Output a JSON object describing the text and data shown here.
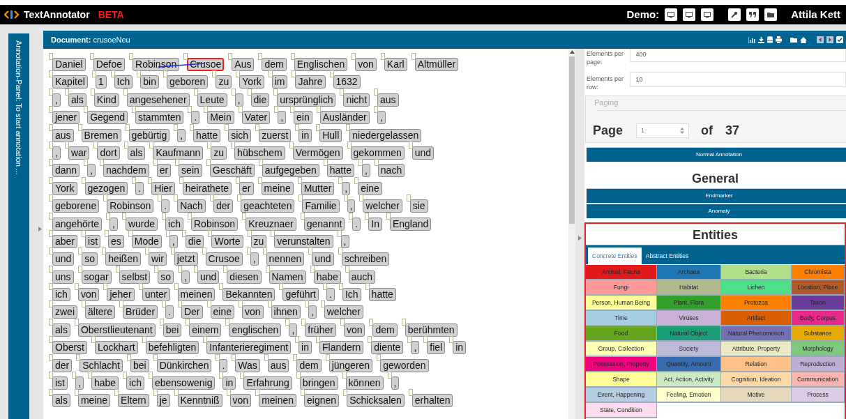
{
  "app": {
    "title": "TextAnnotator",
    "badge": "BETA",
    "demo_label": "Demo:",
    "user": "Attila Kett"
  },
  "sidebar": {
    "label": "Annotation-Panel: To start annotation ..."
  },
  "document": {
    "label": "Document:",
    "name": "crusoeNeu"
  },
  "rows": [
    [
      {
        "text": "Daniel",
        "selected": false
      },
      {
        "text": "Defoe",
        "selected": false
      },
      {
        "text": "Robinson",
        "selected": false,
        "linked_to_next": true
      },
      {
        "text": "Crusoe",
        "selected": true
      },
      {
        "text": "Aus",
        "selected": false
      },
      {
        "text": "dem",
        "selected": false
      },
      {
        "text": "Englischen",
        "selected": false
      },
      {
        "text": "von",
        "selected": false
      },
      {
        "text": "Karl",
        "selected": false
      },
      {
        "text": "Altmüller",
        "selected": false
      }
    ],
    [
      {
        "text": "Kapitel",
        "selected": false
      },
      {
        "text": "1",
        "selected": false
      },
      {
        "text": "Ich",
        "selected": false
      },
      {
        "text": "bin",
        "selected": false
      },
      {
        "text": "geboren",
        "selected": false
      },
      {
        "text": "zu",
        "selected": false
      },
      {
        "text": "York",
        "selected": false
      },
      {
        "text": "im",
        "selected": false
      },
      {
        "text": "Jahre",
        "selected": false
      },
      {
        "text": "1632",
        "selected": false
      }
    ],
    [
      {
        "text": ",",
        "selected": false
      },
      {
        "text": "als",
        "selected": false
      },
      {
        "text": "Kind",
        "selected": false
      },
      {
        "text": "angesehener",
        "selected": false
      },
      {
        "text": "Leute",
        "selected": false
      },
      {
        "text": ",",
        "selected": false
      },
      {
        "text": "die",
        "selected": false
      },
      {
        "text": "ursprünglich",
        "selected": false
      },
      {
        "text": "nicht",
        "selected": false
      },
      {
        "text": "aus",
        "selected": false
      }
    ],
    [
      {
        "text": "jener",
        "selected": false
      },
      {
        "text": "Gegend",
        "selected": false
      },
      {
        "text": "stammten",
        "selected": false
      },
      {
        "text": ".",
        "selected": false
      },
      {
        "text": "Mein",
        "selected": false
      },
      {
        "text": "Vater",
        "selected": false
      },
      {
        "text": ",",
        "selected": false
      },
      {
        "text": "ein",
        "selected": false
      },
      {
        "text": "Ausländer",
        "selected": false
      },
      {
        "text": ",",
        "selected": false
      }
    ],
    [
      {
        "text": "aus",
        "selected": false
      },
      {
        "text": "Bremen",
        "selected": false
      },
      {
        "text": "gebürtig",
        "selected": false
      },
      {
        "text": ",",
        "selected": false
      },
      {
        "text": "hatte",
        "selected": false
      },
      {
        "text": "sich",
        "selected": false
      },
      {
        "text": "zuerst",
        "selected": false
      },
      {
        "text": "in",
        "selected": false
      },
      {
        "text": "Hull",
        "selected": false
      },
      {
        "text": "niedergelassen",
        "selected": false
      }
    ],
    [
      {
        "text": ",",
        "selected": false
      },
      {
        "text": "war",
        "selected": false
      },
      {
        "text": "dort",
        "selected": false
      },
      {
        "text": "als",
        "selected": false
      },
      {
        "text": "Kaufmann",
        "selected": false
      },
      {
        "text": "zu",
        "selected": false
      },
      {
        "text": "hübschem",
        "selected": false
      },
      {
        "text": "Vermögen",
        "selected": false
      },
      {
        "text": "gekommen",
        "selected": false
      },
      {
        "text": "und",
        "selected": false
      }
    ],
    [
      {
        "text": "dann",
        "selected": false
      },
      {
        "text": ",",
        "selected": false
      },
      {
        "text": "nachdem",
        "selected": false
      },
      {
        "text": "er",
        "selected": false
      },
      {
        "text": "sein",
        "selected": false
      },
      {
        "text": "Geschäft",
        "selected": false
      },
      {
        "text": "aufgegeben",
        "selected": false
      },
      {
        "text": "hatte",
        "selected": false
      },
      {
        "text": ",",
        "selected": false
      },
      {
        "text": "nach",
        "selected": false
      }
    ],
    [
      {
        "text": "York",
        "selected": false
      },
      {
        "text": "gezogen",
        "selected": false
      },
      {
        "text": ".",
        "selected": false
      },
      {
        "text": "Hier",
        "selected": false
      },
      {
        "text": "heirathete",
        "selected": false
      },
      {
        "text": "er",
        "selected": false
      },
      {
        "text": "meine",
        "selected": false
      },
      {
        "text": "Mutter",
        "selected": false
      },
      {
        "text": ",",
        "selected": false
      },
      {
        "text": "eine",
        "selected": false
      }
    ],
    [
      {
        "text": "geborene",
        "selected": false
      },
      {
        "text": "Robinson",
        "selected": false
      },
      {
        "text": ".",
        "selected": false
      },
      {
        "text": "Nach",
        "selected": false
      },
      {
        "text": "der",
        "selected": false
      },
      {
        "text": "geachteten",
        "selected": false
      },
      {
        "text": "Familie",
        "selected": false
      },
      {
        "text": ",",
        "selected": false
      },
      {
        "text": "welcher",
        "selected": false
      },
      {
        "text": "sie",
        "selected": false
      }
    ],
    [
      {
        "text": "angehörte",
        "selected": false
      },
      {
        "text": ",",
        "selected": false
      },
      {
        "text": "wurde",
        "selected": false
      },
      {
        "text": "ich",
        "selected": false
      },
      {
        "text": "Robinson",
        "selected": false
      },
      {
        "text": "Kreuznaer",
        "selected": false
      },
      {
        "text": "genannt",
        "selected": false
      },
      {
        "text": ".",
        "selected": false
      },
      {
        "text": "In",
        "selected": false
      },
      {
        "text": "England",
        "selected": false
      }
    ],
    [
      {
        "text": "aber",
        "selected": false
      },
      {
        "text": "ist",
        "selected": false
      },
      {
        "text": "es",
        "selected": false
      },
      {
        "text": "Mode",
        "selected": false
      },
      {
        "text": ",",
        "selected": false
      },
      {
        "text": "die",
        "selected": false
      },
      {
        "text": "Worte",
        "selected": false
      },
      {
        "text": "zu",
        "selected": false
      },
      {
        "text": "verunstalten",
        "selected": false
      },
      {
        "text": ",",
        "selected": false
      }
    ],
    [
      {
        "text": "und",
        "selected": false
      },
      {
        "text": "so",
        "selected": false
      },
      {
        "text": "heißen",
        "selected": false
      },
      {
        "text": "wir",
        "selected": false
      },
      {
        "text": "jetzt",
        "selected": false
      },
      {
        "text": "Crusoe",
        "selected": false
      },
      {
        "text": ",",
        "selected": false
      },
      {
        "text": "nennen",
        "selected": false
      },
      {
        "text": "und",
        "selected": false
      },
      {
        "text": "schreiben",
        "selected": false
      }
    ],
    [
      {
        "text": "uns",
        "selected": false
      },
      {
        "text": "sogar",
        "selected": false
      },
      {
        "text": "selbst",
        "selected": false
      },
      {
        "text": "so",
        "selected": false
      },
      {
        "text": ",",
        "selected": false
      },
      {
        "text": "und",
        "selected": false
      },
      {
        "text": "diesen",
        "selected": false
      },
      {
        "text": "Namen",
        "selected": false
      },
      {
        "text": "habe",
        "selected": false
      },
      {
        "text": "auch",
        "selected": false
      }
    ],
    [
      {
        "text": "ich",
        "selected": false
      },
      {
        "text": "von",
        "selected": false
      },
      {
        "text": "jeher",
        "selected": false
      },
      {
        "text": "unter",
        "selected": false
      },
      {
        "text": "meinen",
        "selected": false
      },
      {
        "text": "Bekannten",
        "selected": false
      },
      {
        "text": "geführt",
        "selected": false
      },
      {
        "text": ".",
        "selected": false
      },
      {
        "text": "Ich",
        "selected": false
      },
      {
        "text": "hatte",
        "selected": false
      }
    ],
    [
      {
        "text": "zwei",
        "selected": false
      },
      {
        "text": "ältere",
        "selected": false
      },
      {
        "text": "Brüder",
        "selected": false
      },
      {
        "text": ".",
        "selected": false
      },
      {
        "text": "Der",
        "selected": false
      },
      {
        "text": "eine",
        "selected": false
      },
      {
        "text": "von",
        "selected": false
      },
      {
        "text": "ihnen",
        "selected": false
      },
      {
        "text": ",",
        "selected": false
      },
      {
        "text": "welcher",
        "selected": false
      }
    ],
    [
      {
        "text": "als",
        "selected": false
      },
      {
        "text": "Oberstlieutenant",
        "selected": false
      },
      {
        "text": "bei",
        "selected": false
      },
      {
        "text": "einem",
        "selected": false
      },
      {
        "text": "englischen",
        "selected": false
      },
      {
        "text": ",",
        "selected": false
      },
      {
        "text": "früher",
        "selected": false
      },
      {
        "text": "von",
        "selected": false
      },
      {
        "text": "dem",
        "selected": false
      },
      {
        "text": "berühmten",
        "selected": false
      }
    ],
    [
      {
        "text": "Oberst",
        "selected": false
      },
      {
        "text": "Lockhart",
        "selected": false
      },
      {
        "text": "befehligten",
        "selected": false
      },
      {
        "text": "Infanterieregiment",
        "selected": false
      },
      {
        "text": "in",
        "selected": false
      },
      {
        "text": "Flandern",
        "selected": false
      },
      {
        "text": "diente",
        "selected": false
      },
      {
        "text": ",",
        "selected": false
      },
      {
        "text": "fiel",
        "selected": false
      },
      {
        "text": "in",
        "selected": false
      }
    ],
    [
      {
        "text": "der",
        "selected": false
      },
      {
        "text": "Schlacht",
        "selected": false
      },
      {
        "text": "bei",
        "selected": false
      },
      {
        "text": "Dünkirchen",
        "selected": false
      },
      {
        "text": ".",
        "selected": false
      },
      {
        "text": "Was",
        "selected": false
      },
      {
        "text": "aus",
        "selected": false
      },
      {
        "text": "dem",
        "selected": false
      },
      {
        "text": "jüngeren",
        "selected": false
      },
      {
        "text": "geworden",
        "selected": false
      }
    ],
    [
      {
        "text": "ist",
        "selected": false
      },
      {
        "text": ",",
        "selected": false
      },
      {
        "text": "habe",
        "selected": false
      },
      {
        "text": "ich",
        "selected": false
      },
      {
        "text": "ebensowenig",
        "selected": false
      },
      {
        "text": "in",
        "selected": false
      },
      {
        "text": "Erfahrung",
        "selected": false
      },
      {
        "text": "bringen",
        "selected": false
      },
      {
        "text": "können",
        "selected": false
      },
      {
        "text": ",",
        "selected": false
      }
    ],
    [
      {
        "text": "als",
        "selected": false
      },
      {
        "text": "meine",
        "selected": false
      },
      {
        "text": "Eltern",
        "selected": false
      },
      {
        "text": "je",
        "selected": false
      },
      {
        "text": "Kenntniß",
        "selected": false
      },
      {
        "text": "von",
        "selected": false
      },
      {
        "text": "meinen",
        "selected": false
      },
      {
        "text": "eignen",
        "selected": false
      },
      {
        "text": "Schicksalen",
        "selected": false
      },
      {
        "text": "erhalten",
        "selected": false
      }
    ]
  ],
  "settings": [
    {
      "label": "Elements per page:",
      "value": "400"
    },
    {
      "label": "Elements per row:",
      "value": "10"
    }
  ],
  "paging": {
    "legend": "Paging",
    "label": "Page",
    "value": "1",
    "of": "of",
    "total": "37"
  },
  "mode_button": "Normal Annotation",
  "general": {
    "title": "General",
    "buttons": [
      "Endmarker",
      "Anomaly"
    ]
  },
  "entities": {
    "title": "Entities",
    "tabs": [
      {
        "label": "Concrete Entities",
        "selected": true
      },
      {
        "label": "Abstract Entities",
        "selected": false
      }
    ],
    "types": [
      {
        "label": "Animal, Fauna",
        "color": "#e31a1c"
      },
      {
        "label": "Archaea",
        "color": "#1f78b4"
      },
      {
        "label": "Bacteria",
        "color": "#b2df8a"
      },
      {
        "label": "Chromista",
        "color": "#ff7f00"
      },
      {
        "label": "Fungi",
        "color": "#fb9a99"
      },
      {
        "label": "Habitat",
        "color": "#b3b98f"
      },
      {
        "label": "Lichen",
        "color": "#4fdf8a"
      },
      {
        "label": "Location, Place",
        "color": "#b15928"
      },
      {
        "label": "Person, Human Being",
        "color": "#ffff99"
      },
      {
        "label": "Plant, Flora",
        "color": "#33a02c"
      },
      {
        "label": "Protozoa",
        "color": "#ff7f00"
      },
      {
        "label": "Taxon",
        "color": "#6a3d9a"
      },
      {
        "label": "Time",
        "color": "#a6cee3"
      },
      {
        "label": "Viruses",
        "color": "#cab2d6"
      },
      {
        "label": "Artifact",
        "color": "#d95f02"
      },
      {
        "label": "Body, Corpus",
        "color": "#e7298a"
      },
      {
        "label": "Food",
        "color": "#66a61e"
      },
      {
        "label": "Natural Object",
        "color": "#1b9e77"
      },
      {
        "label": "Natural Phenomenon",
        "color": "#7570b3"
      },
      {
        "label": "Substance",
        "color": "#e6ab02"
      },
      {
        "label": "Group, Collection",
        "color": "#ffffb3"
      },
      {
        "label": "Society",
        "color": "#bebada"
      },
      {
        "label": "Attribute, Property",
        "color": "#eaeac4"
      },
      {
        "label": "Morphology",
        "color": "#7fc97f"
      },
      {
        "label": "Possession, Property",
        "color": "#f0027f"
      },
      {
        "label": "Quantity, Amount",
        "color": "#386cb0"
      },
      {
        "label": "Relation",
        "color": "#fdc086"
      },
      {
        "label": "Reproduction",
        "color": "#beaed4"
      },
      {
        "label": "Shape",
        "color": "#ffff99"
      },
      {
        "label": "Act, Action, Activity",
        "color": "#ccebc5"
      },
      {
        "label": "Cognition, Ideation",
        "color": "#fed9a6"
      },
      {
        "label": "Communication",
        "color": "#fbb4ae"
      },
      {
        "label": "Event, Happening",
        "color": "#b3cde3"
      },
      {
        "label": "Feeling, Emotion",
        "color": "#ffffcc"
      },
      {
        "label": "Motive",
        "color": "#e5d8bd"
      },
      {
        "label": "Process",
        "color": "#decbe4"
      },
      {
        "label": "State, Condition",
        "color": "#fddaec"
      }
    ]
  }
}
